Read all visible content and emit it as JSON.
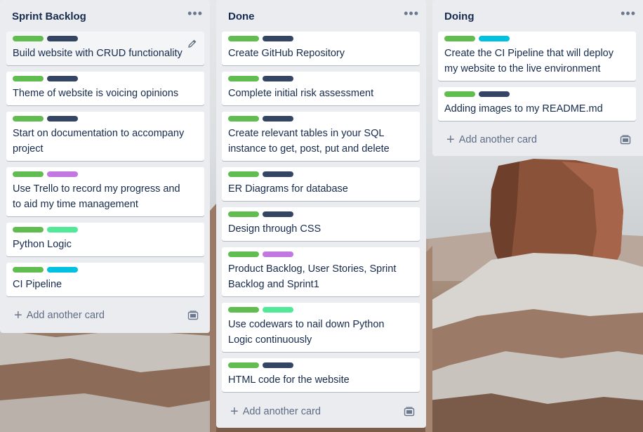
{
  "lists": [
    {
      "title": "Sprint Backlog",
      "menu": "•••",
      "add_label": "Add another card",
      "cards": [
        {
          "title": "Build website with CRUD functionality",
          "labels": [
            "green",
            "navy"
          ]
        },
        {
          "title": "Theme of website is voicing opinions",
          "labels": [
            "green",
            "navy"
          ]
        },
        {
          "title": "Start on documentation to accompany",
          "title2": "project",
          "labels": [
            "green",
            "navy"
          ]
        },
        {
          "title": "Use Trello to record my progress and",
          "title2": "to aid my time management",
          "labels": [
            "green",
            "purple"
          ]
        },
        {
          "title": "Python Logic",
          "labels": [
            "green",
            "mint"
          ]
        },
        {
          "title": "CI Pipeline",
          "labels": [
            "green",
            "sky"
          ]
        }
      ]
    },
    {
      "title": "Done",
      "menu": "•••",
      "add_label": "Add another card",
      "cards": [
        {
          "title": "Create GitHub Repository",
          "labels": [
            "green",
            "navy"
          ]
        },
        {
          "title": "Complete initial risk assessment",
          "labels": [
            "green",
            "navy"
          ]
        },
        {
          "title": "Create relevant tables in your SQL",
          "title2": "instance to get, post, put and delete",
          "labels": [
            "green",
            "navy"
          ]
        },
        {
          "title": "ER Diagrams for database",
          "labels": [
            "green",
            "navy"
          ]
        },
        {
          "title": "Design through CSS",
          "labels": [
            "green",
            "navy"
          ]
        },
        {
          "title": "Product Backlog, User Stories, Sprint",
          "title2": "Backlog and Sprint1",
          "labels": [
            "green",
            "purple"
          ]
        },
        {
          "title": "Use codewars to nail down Python",
          "title2": "Logic continuously",
          "labels": [
            "green",
            "mint"
          ]
        },
        {
          "title": "HTML code for the website",
          "labels": [
            "green",
            "navy"
          ]
        }
      ]
    },
    {
      "title": "Doing",
      "menu": "•••",
      "add_label": "Add another card",
      "cards": [
        {
          "title": "Create the CI Pipeline that will deploy",
          "title2": "my website to the live environment",
          "labels": [
            "green",
            "sky"
          ]
        },
        {
          "title": "Adding images to my README.md",
          "labels": [
            "green",
            "navy"
          ]
        }
      ]
    }
  ],
  "label_colors": {
    "green": "#61bd4f",
    "navy": "#344563",
    "purple": "#c377e0",
    "mint": "#51e898",
    "sky": "#00c2e0"
  }
}
